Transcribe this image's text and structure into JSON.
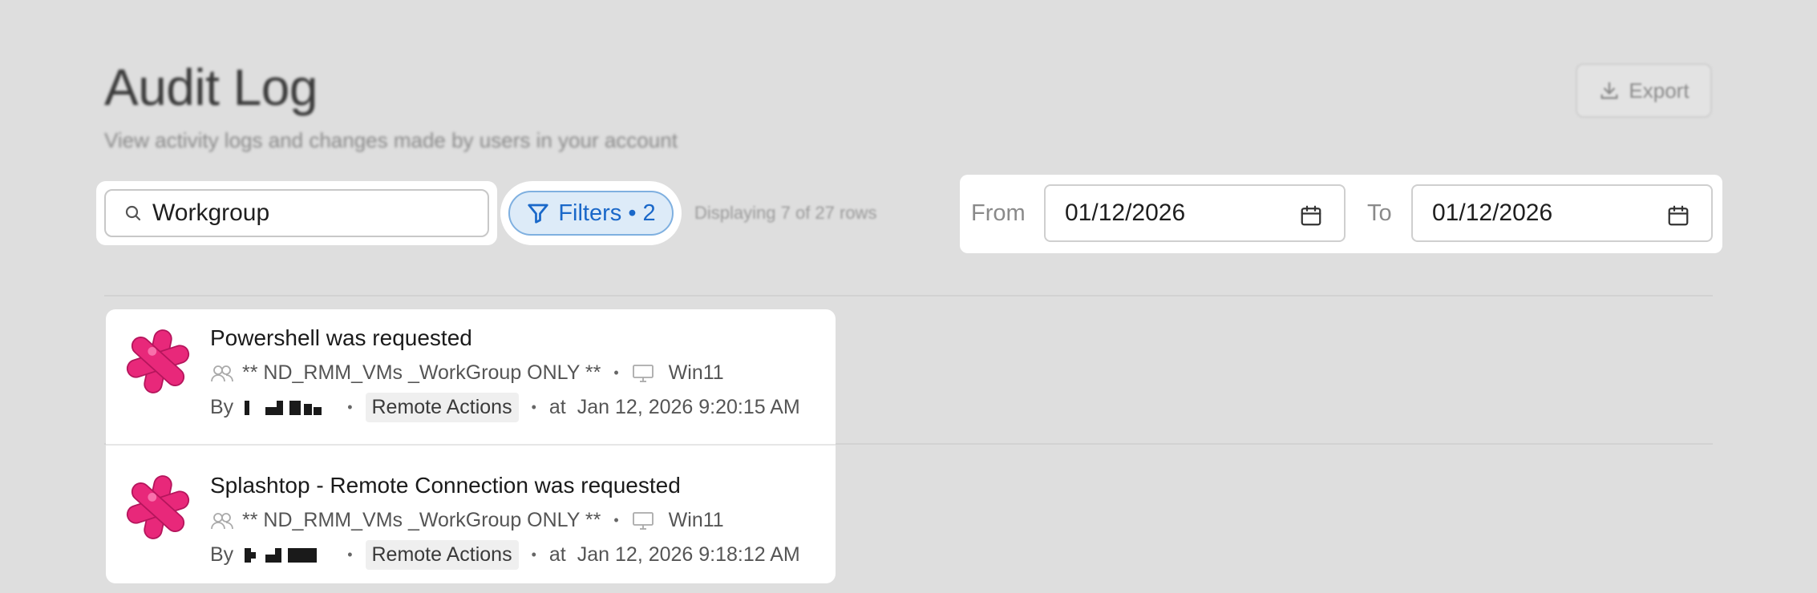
{
  "header": {
    "title": "Audit Log",
    "subtitle": "View activity logs and changes made by users in your account",
    "export_label": "Export"
  },
  "search": {
    "value": "Workgroup",
    "icon": "search-icon"
  },
  "filters": {
    "label": "Filters • 2",
    "icon": "filter-icon"
  },
  "displaying": "Displaying 7 of 27 rows",
  "date_range": {
    "from_label": "From",
    "from_value": "01/12/2026",
    "to_label": "To",
    "to_value": "01/12/2026",
    "icon": "calendar-icon"
  },
  "events": [
    {
      "title": "Powershell was requested",
      "group": "** ND_RMM_VMs _WorkGroup ONLY **",
      "device": "Win11",
      "by_label": "By",
      "category": "Remote Actions",
      "at_label": "at",
      "timestamp": "Jan 12, 2026 9:20:15 AM"
    },
    {
      "title": "Splashtop - Remote Connection was requested",
      "group": "** ND_RMM_VMs _WorkGroup ONLY **",
      "device": "Win11",
      "by_label": "By",
      "category": "Remote Actions",
      "at_label": "at",
      "timestamp": "Jan 12, 2026 9:18:12 AM"
    }
  ],
  "colors": {
    "accent": "#1a68c9",
    "logo": "#e8287a",
    "background": "#dedede"
  }
}
